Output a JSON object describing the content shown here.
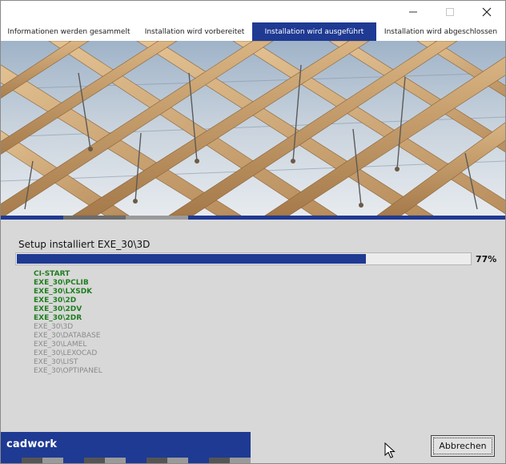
{
  "window": {
    "controls": {
      "minimize": "minimize-icon",
      "maximize": "maximize-icon",
      "close": "close-icon"
    }
  },
  "tabs": [
    {
      "label": "Informationen werden gesammelt",
      "active": false
    },
    {
      "label": "Installation wird vorbereitet",
      "active": false
    },
    {
      "label": "Installation wird ausgeführt",
      "active": true
    },
    {
      "label": "Installation wird abgeschlossen",
      "active": false
    }
  ],
  "hero": {
    "icon": "timber-roof-photo"
  },
  "install": {
    "status_text": "Setup installiert EXE_30\\3D",
    "progress": 0.77,
    "progress_label": "77%",
    "steps": [
      {
        "label": "CI-START",
        "done": true
      },
      {
        "label": "EXE_30\\PCLIB",
        "done": true
      },
      {
        "label": "EXE_30\\LXSDK",
        "done": true
      },
      {
        "label": "EXE_30\\2D",
        "done": true
      },
      {
        "label": "EXE_30\\2DV",
        "done": true
      },
      {
        "label": "EXE_30\\2DR",
        "done": true
      },
      {
        "label": "EXE_30\\3D",
        "done": false
      },
      {
        "label": "EXE_30\\DATABASE",
        "done": false
      },
      {
        "label": "EXE_30\\LAMEL",
        "done": false
      },
      {
        "label": "EXE_30\\LEXOCAD",
        "done": false
      },
      {
        "label": "EXE_30\\LIST",
        "done": false
      },
      {
        "label": "EXE_30\\OPTIPANEL",
        "done": false
      }
    ]
  },
  "footer": {
    "brand": "cadwork",
    "cancel_label": "Abbrechen"
  },
  "colors": {
    "accent": "#1f3a93",
    "done": "#1e7f1e",
    "pending": "#8a8a8a",
    "background": "#d8d8d8"
  }
}
